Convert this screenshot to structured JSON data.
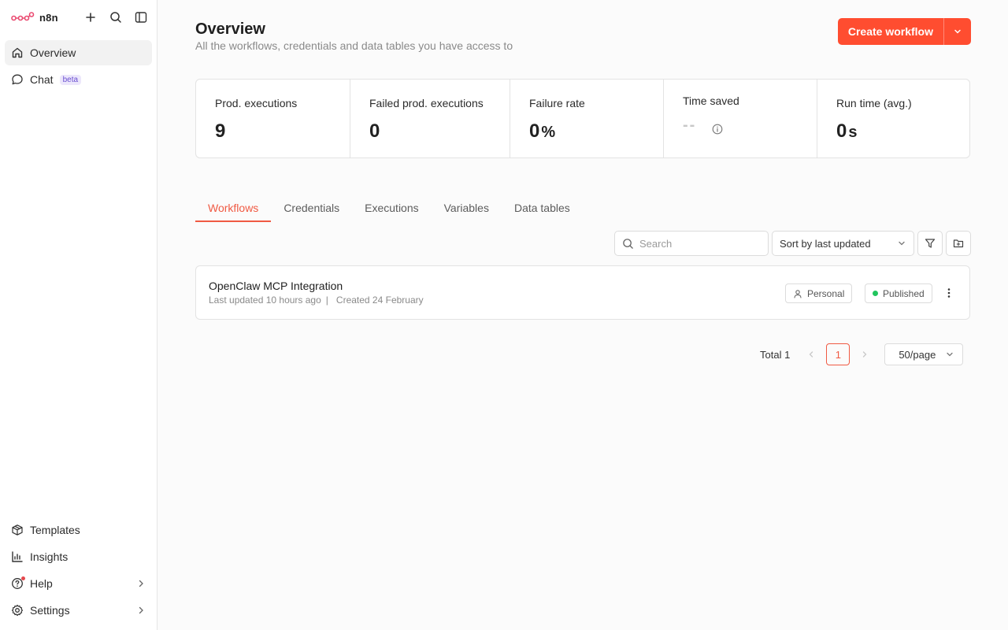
{
  "app": {
    "logo_text": "n8n"
  },
  "sidebar": {
    "items": [
      {
        "label": "Overview",
        "icon": "home-icon"
      },
      {
        "label": "Chat",
        "badge": "beta",
        "icon": "chat-icon"
      }
    ],
    "bottom_items": [
      {
        "label": "Templates",
        "icon": "box-icon"
      },
      {
        "label": "Insights",
        "icon": "bar-chart-icon"
      },
      {
        "label": "Help",
        "icon": "help-icon"
      },
      {
        "label": "Settings",
        "icon": "gear-icon"
      }
    ]
  },
  "header": {
    "title": "Overview",
    "subtitle": "All the workflows, credentials and data tables you have access to",
    "create_label": "Create workflow"
  },
  "stats": [
    {
      "label": "Prod. executions",
      "value": "9",
      "unit": ""
    },
    {
      "label": "Failed prod. executions",
      "value": "0",
      "unit": ""
    },
    {
      "label": "Failure rate",
      "value": "0",
      "unit": "%"
    },
    {
      "label": "Time saved",
      "value": "--",
      "unit": ""
    },
    {
      "label": "Run time (avg.)",
      "value": "0",
      "unit": "s"
    }
  ],
  "tabs": [
    {
      "label": "Workflows"
    },
    {
      "label": "Credentials"
    },
    {
      "label": "Executions"
    },
    {
      "label": "Variables"
    },
    {
      "label": "Data tables"
    }
  ],
  "toolbar": {
    "search_placeholder": "Search",
    "sort_label": "Sort by last updated"
  },
  "workflows": [
    {
      "name": "OpenClaw MCP Integration",
      "updated": "Last updated 10 hours ago",
      "sep": "|",
      "created": "Created 24 February",
      "owner": "Personal",
      "status": "Published"
    }
  ],
  "pagination": {
    "total": "Total 1",
    "current_page": "1",
    "page_size": "50/page"
  },
  "colors": {
    "accent": "#ff4d30",
    "tab_active": "#f05a43",
    "published": "#22c55e"
  }
}
